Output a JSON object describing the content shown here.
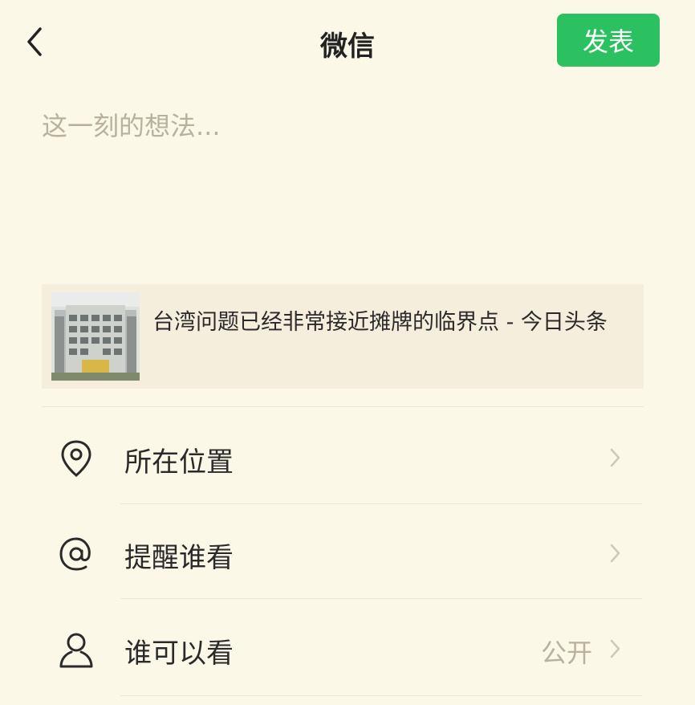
{
  "header": {
    "back_icon": "chevron-left-icon",
    "title": "微信",
    "publish_label": "发表"
  },
  "composer": {
    "placeholder": "这一刻的想法..."
  },
  "shared_link": {
    "title": "台湾问题已经非常接近摊牌的临界点 - 今日头条"
  },
  "options": [
    {
      "icon": "location-pin-icon",
      "label": "所在位置",
      "value": ""
    },
    {
      "icon": "at-sign-icon",
      "label": "提醒谁看",
      "value": ""
    },
    {
      "icon": "person-icon",
      "label": "谁可以看",
      "value": "公开"
    }
  ],
  "colors": {
    "background": "#fcf8e8",
    "accent": "#2bc160",
    "card": "#f6eedc",
    "muted_text": "#b9b09e"
  }
}
